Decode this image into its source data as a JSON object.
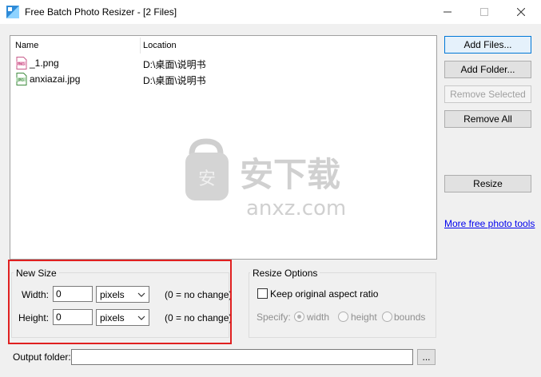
{
  "window": {
    "title": "Free Batch Photo Resizer - [2 Files]",
    "minimize_icon": "minimize-icon",
    "maximize_icon": "maximize-icon",
    "close_icon": "close-icon"
  },
  "file_list": {
    "columns": [
      "Name",
      "Location"
    ],
    "rows": [
      {
        "name": "_1.png",
        "location": "D:\\桌面\\说明书",
        "icon": "png-file-icon"
      },
      {
        "name": "anxiazai.jpg",
        "location": "D:\\桌面\\说明书",
        "icon": "jpg-file-icon"
      }
    ]
  },
  "watermark": {
    "brand": "安下载",
    "domain": "anxz.com",
    "icon": "shield-lock-icon"
  },
  "buttons": {
    "add_files": "Add Files...",
    "add_folder": "Add Folder...",
    "remove_selected": "Remove Selected",
    "remove_all": "Remove All",
    "resize": "Resize"
  },
  "link": "More free photo tools",
  "new_size": {
    "label": "New Size",
    "width_label": "Width:",
    "width_value": "0",
    "width_unit": "pixels",
    "width_hint": "(0 = no change)",
    "height_label": "Height:",
    "height_value": "0",
    "height_unit": "pixels",
    "height_hint": "(0 = no change)"
  },
  "resize_options": {
    "label": "Resize Options",
    "keep_aspect_label": "Keep original aspect ratio",
    "keep_aspect_checked": false,
    "specify_label": "Specify:",
    "options": [
      "width",
      "height",
      "bounds"
    ],
    "selected": "width"
  },
  "output": {
    "label": "Output folder:",
    "value": "",
    "browse_label": "..."
  },
  "colors": {
    "highlight": "#e02020",
    "accent": "#0078d7",
    "link": "#0000ee"
  }
}
